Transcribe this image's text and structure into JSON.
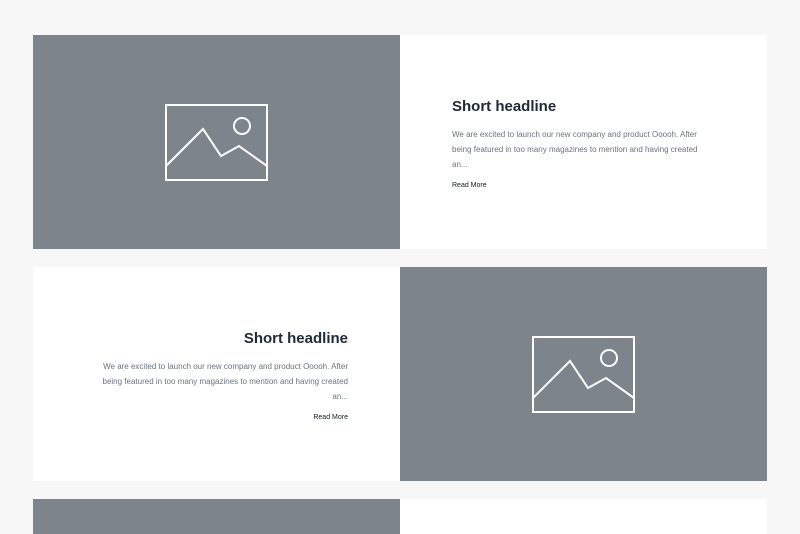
{
  "cards": [
    {
      "headline": "Short headline",
      "description": "We are excited to launch our new company and product Ooooh. After being featured in too many magazines to mention and having created an...",
      "link": "Read More"
    },
    {
      "headline": "Short headline",
      "description": "We are excited to launch our new company and product Ooooh. After being featured in too many magazines to mention and having created an...",
      "link": "Read More"
    }
  ],
  "colors": {
    "background": "#f7f7f8",
    "card": "#ffffff",
    "placeholder": "#7e848b",
    "headline": "#1f2937",
    "body": "#6b7280"
  },
  "icons": [
    "image-placeholder-icon"
  ]
}
